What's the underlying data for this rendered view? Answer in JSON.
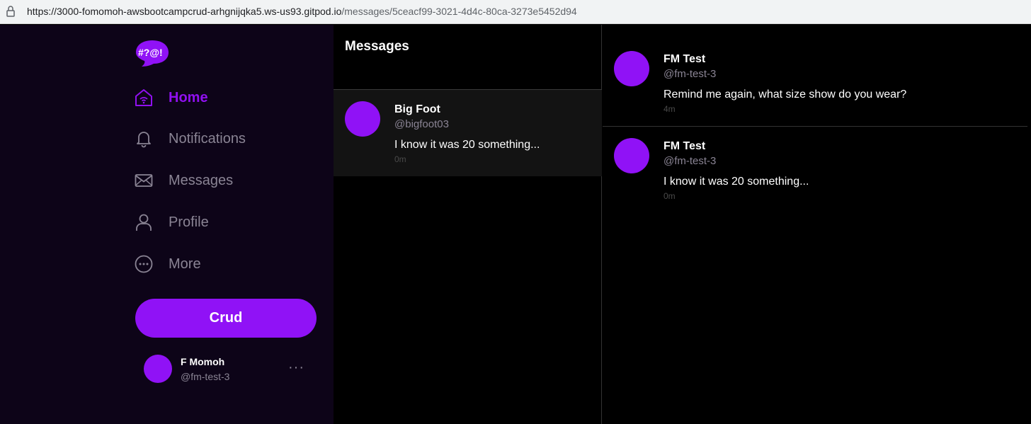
{
  "browser": {
    "url_host": "https://3000-fomomoh-awsbootcampcrud-arhgnijqka5.ws-us93.gitpod.io",
    "url_path": "/messages/5ceacf99-3021-4d4c-80ca-3273e5452d94"
  },
  "logo": {
    "text": "#?@!"
  },
  "nav": {
    "items": [
      {
        "label": "Home",
        "icon": "home-icon",
        "active": true
      },
      {
        "label": "Notifications",
        "icon": "bell-icon",
        "active": false
      },
      {
        "label": "Messages",
        "icon": "envelope-icon",
        "active": false
      },
      {
        "label": "Profile",
        "icon": "user-icon",
        "active": false
      },
      {
        "label": "More",
        "icon": "more-circle-icon",
        "active": false
      }
    ]
  },
  "crud_button": {
    "label": "Crud"
  },
  "profile": {
    "name": "F Momoh",
    "handle": "@fm-test-3",
    "menu": "···"
  },
  "messages_list": {
    "title": "Messages",
    "groups": [
      {
        "name": "Big Foot",
        "handle": "@bigfoot03",
        "message": "I know it was 20 something...",
        "time": "0m"
      }
    ]
  },
  "conversation": {
    "messages": [
      {
        "name": "FM Test",
        "handle": "@fm-test-3",
        "text": "Remind me again, what size show do you wear?",
        "time": "4m"
      },
      {
        "name": "FM Test",
        "handle": "@fm-test-3",
        "text": "I know it was 20 something...",
        "time": "0m"
      }
    ]
  },
  "colors": {
    "accent": "#9012f6",
    "sidebar_bg": "#0d0418",
    "muted": "#8a8494"
  }
}
